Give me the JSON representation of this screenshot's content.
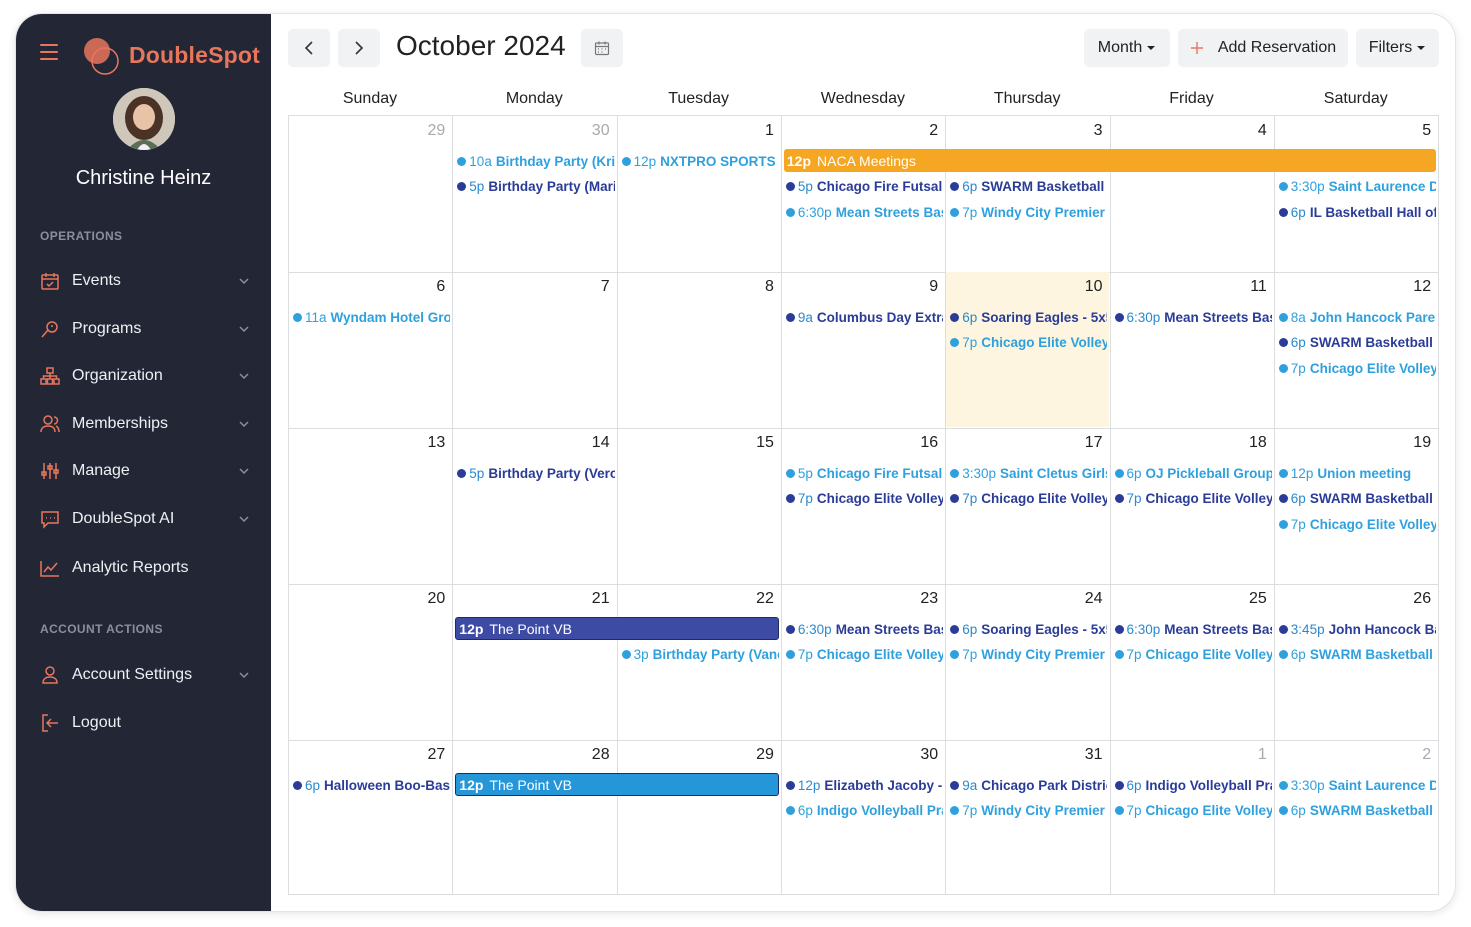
{
  "app": {
    "name": "DoubleSpot"
  },
  "user": {
    "name": "Christine Heinz"
  },
  "sidebar": {
    "operations_title": "OPERATIONS",
    "items": [
      {
        "label": "Events",
        "icon": "calendar-check-icon"
      },
      {
        "label": "Programs",
        "icon": "whistle-icon"
      },
      {
        "label": "Organization",
        "icon": "org-chart-icon"
      },
      {
        "label": "Memberships",
        "icon": "users-icon"
      },
      {
        "label": "Manage",
        "icon": "sliders-icon"
      },
      {
        "label": "DoubleSpot AI",
        "icon": "chat-icon"
      },
      {
        "label": "Analytic Reports",
        "icon": "chart-line-icon"
      }
    ],
    "account_title": "ACCOUNT ACTIONS",
    "account_items": [
      {
        "label": "Account Settings",
        "icon": "user-icon"
      },
      {
        "label": "Logout",
        "icon": "logout-icon"
      }
    ]
  },
  "toolbar": {
    "title": "October 2024",
    "view_label": "Month",
    "add_label": "Add Reservation",
    "filters_label": "Filters"
  },
  "colors": {
    "accent": "#e8765c",
    "sidebar_bg": "#232735",
    "today_bg": "#fdf5df",
    "event_dark": "#2a3c97",
    "event_light": "#2fa0de",
    "orange_bar": "#f5a623",
    "indigo_bar": "#3d4ba4",
    "blue_bar": "#2596d8"
  },
  "calendar": {
    "weekdays": [
      "Sunday",
      "Monday",
      "Tuesday",
      "Wednesday",
      "Thursday",
      "Friday",
      "Saturday"
    ],
    "today": "10",
    "weeks": [
      {
        "days": [
          {
            "n": "29",
            "other": true,
            "events": []
          },
          {
            "n": "30",
            "other": true,
            "events": [
              {
                "time": "10a",
                "name": "Birthday Party (Kris",
                "tone": "light"
              },
              {
                "time": "5p",
                "name": "Birthday Party (Maria",
                "tone": "dark"
              }
            ]
          },
          {
            "n": "1",
            "events": [
              {
                "time": "12p",
                "name": "NXTPRO SPORTS -",
                "tone": "light"
              }
            ]
          },
          {
            "n": "2",
            "events": [
              {
                "slot": 1,
                "time": "5p",
                "name": "Chicago Fire Futsal",
                "tone": "dark"
              },
              {
                "time": "6:30p",
                "name": "Mean Streets Bas",
                "tone": "light"
              }
            ]
          },
          {
            "n": "3",
            "events": [
              {
                "slot": 1,
                "time": "6p",
                "name": "SWARM Basketball F",
                "tone": "dark"
              },
              {
                "time": "7p",
                "name": "Windy City Premier V",
                "tone": "light"
              }
            ]
          },
          {
            "n": "4",
            "events": []
          },
          {
            "n": "5",
            "events": [
              {
                "slot": 1,
                "time": "3:30p",
                "name": "Saint Laurence Da",
                "tone": "light"
              },
              {
                "time": "6p",
                "name": "IL Basketball Hall of F",
                "tone": "dark"
              }
            ]
          }
        ],
        "bars": [
          {
            "start": 3,
            "span": 4,
            "time": "12p",
            "name": "NACA Meetings",
            "color": "orange"
          }
        ]
      },
      {
        "days": [
          {
            "n": "6",
            "events": [
              {
                "time": "11a",
                "name": "Wyndam Hotel Grou",
                "tone": "light"
              }
            ]
          },
          {
            "n": "7",
            "events": []
          },
          {
            "n": "8",
            "events": []
          },
          {
            "n": "9",
            "events": [
              {
                "time": "9a",
                "name": "Columbus Day Extrav",
                "tone": "dark"
              }
            ]
          },
          {
            "n": "10",
            "events": [
              {
                "time": "6p",
                "name": "Soaring Eagles - 5x5",
                "tone": "dark"
              },
              {
                "time": "7p",
                "name": "Chicago Elite Volleyb",
                "tone": "light"
              }
            ]
          },
          {
            "n": "11",
            "events": [
              {
                "time": "6:30p",
                "name": "Mean Streets Bas",
                "tone": "dark"
              }
            ]
          },
          {
            "n": "12",
            "events": [
              {
                "time": "8a",
                "name": "John Hancock Parent",
                "tone": "light"
              },
              {
                "time": "6p",
                "name": "SWARM Basketball F",
                "tone": "dark"
              },
              {
                "time": "7p",
                "name": "Chicago Elite Volleyb",
                "tone": "light"
              }
            ]
          }
        ],
        "bars": []
      },
      {
        "days": [
          {
            "n": "13",
            "events": []
          },
          {
            "n": "14",
            "events": [
              {
                "time": "5p",
                "name": "Birthday Party (Veron",
                "tone": "dark"
              }
            ]
          },
          {
            "n": "15",
            "events": []
          },
          {
            "n": "16",
            "events": [
              {
                "time": "5p",
                "name": "Chicago Fire Futsal",
                "tone": "light"
              },
              {
                "time": "7p",
                "name": "Chicago Elite Volleyb",
                "tone": "dark"
              }
            ]
          },
          {
            "n": "17",
            "events": [
              {
                "time": "3:30p",
                "name": "Saint Cletus Girls",
                "tone": "light"
              },
              {
                "time": "7p",
                "name": "Chicago Elite Volleyb",
                "tone": "dark"
              }
            ]
          },
          {
            "n": "18",
            "events": [
              {
                "time": "6p",
                "name": "OJ Pickleball Group",
                "tone": "light"
              },
              {
                "time": "7p",
                "name": "Chicago Elite Volleyb",
                "tone": "dark"
              }
            ]
          },
          {
            "n": "19",
            "events": [
              {
                "time": "12p",
                "name": "Union meeting",
                "tone": "light"
              },
              {
                "time": "6p",
                "name": "SWARM Basketball F",
                "tone": "dark"
              },
              {
                "time": "7p",
                "name": "Chicago Elite Volleyb",
                "tone": "light"
              }
            ]
          }
        ],
        "bars": []
      },
      {
        "days": [
          {
            "n": "20",
            "events": []
          },
          {
            "n": "21",
            "events": []
          },
          {
            "n": "22",
            "events": [
              {
                "slot": 1,
                "time": "3p",
                "name": "Birthday Party (Vane",
                "tone": "light"
              }
            ]
          },
          {
            "n": "23",
            "events": [
              {
                "time": "6:30p",
                "name": "Mean Streets Bas",
                "tone": "dark"
              },
              {
                "time": "7p",
                "name": "Chicago Elite Volleyb",
                "tone": "light"
              }
            ]
          },
          {
            "n": "24",
            "events": [
              {
                "time": "6p",
                "name": "Soaring Eagles - 5x5",
                "tone": "dark"
              },
              {
                "time": "7p",
                "name": "Windy City Premier V",
                "tone": "light"
              }
            ]
          },
          {
            "n": "25",
            "events": [
              {
                "time": "6:30p",
                "name": "Mean Streets Bas",
                "tone": "dark"
              },
              {
                "time": "7p",
                "name": "Chicago Elite Volleyb",
                "tone": "light"
              }
            ]
          },
          {
            "n": "26",
            "events": [
              {
                "time": "3:45p",
                "name": "John Hancock Bas",
                "tone": "dark"
              },
              {
                "time": "6p",
                "name": "SWARM Basketball F",
                "tone": "light"
              }
            ]
          }
        ],
        "bars": [
          {
            "start": 1,
            "span": 2,
            "time": "12p",
            "name": "The Point VB",
            "color": "indigo"
          }
        ]
      },
      {
        "days": [
          {
            "n": "27",
            "events": [
              {
                "time": "6p",
                "name": "Halloween Boo-Bash",
                "tone": "dark"
              }
            ]
          },
          {
            "n": "28",
            "events": []
          },
          {
            "n": "29",
            "events": []
          },
          {
            "n": "30",
            "events": [
              {
                "time": "12p",
                "name": "Elizabeth Jacoby - V",
                "tone": "dark"
              },
              {
                "time": "6p",
                "name": "Indigo Volleyball Pra",
                "tone": "light"
              }
            ]
          },
          {
            "n": "31",
            "events": [
              {
                "time": "9a",
                "name": "Chicago Park District",
                "tone": "dark"
              },
              {
                "time": "7p",
                "name": "Windy City Premier V",
                "tone": "light"
              }
            ]
          },
          {
            "n": "1",
            "other": true,
            "events": [
              {
                "time": "6p",
                "name": "Indigo Volleyball Pra",
                "tone": "dark"
              },
              {
                "time": "7p",
                "name": "Chicago Elite Volleyb",
                "tone": "light"
              }
            ]
          },
          {
            "n": "2",
            "other": true,
            "events": [
              {
                "time": "3:30p",
                "name": "Saint Laurence Da",
                "tone": "light"
              },
              {
                "time": "6p",
                "name": "SWARM Basketball F",
                "tone": "light"
              }
            ]
          }
        ],
        "bars": [
          {
            "start": 1,
            "span": 2,
            "time": "12p",
            "name": "The Point VB",
            "color": "blue"
          }
        ]
      }
    ]
  }
}
